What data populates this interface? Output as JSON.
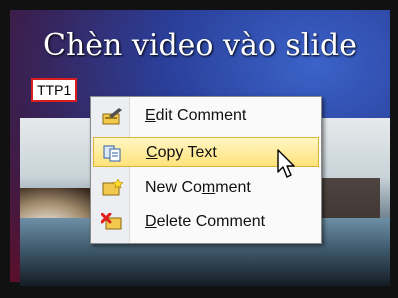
{
  "slide": {
    "title": "Chèn video vào slide",
    "comment_tag": "TTP1"
  },
  "context_menu": {
    "items": [
      {
        "pre": "",
        "u": "E",
        "post": "dit Comment",
        "icon": "edit-comment-icon"
      },
      {
        "pre": "",
        "u": "C",
        "post": "opy Text",
        "icon": "copy-text-icon"
      },
      {
        "pre": "New Co",
        "u": "m",
        "post": "ment",
        "icon": "new-comment-icon"
      },
      {
        "pre": "",
        "u": "D",
        "post": "elete Comment",
        "icon": "delete-comment-icon"
      }
    ],
    "highlighted_index": 1
  }
}
